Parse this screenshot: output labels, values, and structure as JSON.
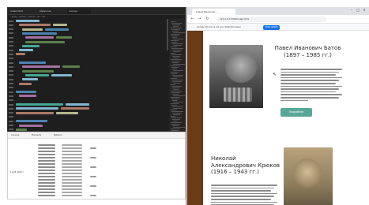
{
  "editor": {
    "tabs": [
      {
        "label": "index.html"
      },
      {
        "label": "styles.css"
      },
      {
        "label": "main.js"
      }
    ],
    "breadcrumb": "› body › section › article › div › div"
  },
  "output_panel": {
    "tabs": [
      {
        "label": "Console"
      },
      {
        "label": "Elements"
      },
      {
        "label": "Network"
      }
    ],
    "side_value": "11.05.1941 г."
  },
  "browser": {
    "tab_title": "Герои Великой...",
    "url": "127.0.0.1:5500/index.html",
    "notice_text": "Google Chrome is not your default browser",
    "notice_button": "Make default",
    "window_controls": {
      "min": "–",
      "max": "□",
      "close": "✕"
    },
    "nav": {
      "back": "←",
      "forward": "→",
      "reload": "↻"
    }
  },
  "page": {
    "hero1": {
      "name": "Павел Иванович Батов",
      "dates": "(1897 – 1985 гг.)",
      "button_label": "Подробнее"
    },
    "hero2": {
      "name_line1": "Николай",
      "name_line2": "Александрович Крюков",
      "dates": "(1916 – 1943 гг.)"
    }
  },
  "colors": {
    "accent_button": "#5aa69b",
    "sidebar_band": "#6b3a17",
    "editor_bg": "#1e1e1e"
  }
}
